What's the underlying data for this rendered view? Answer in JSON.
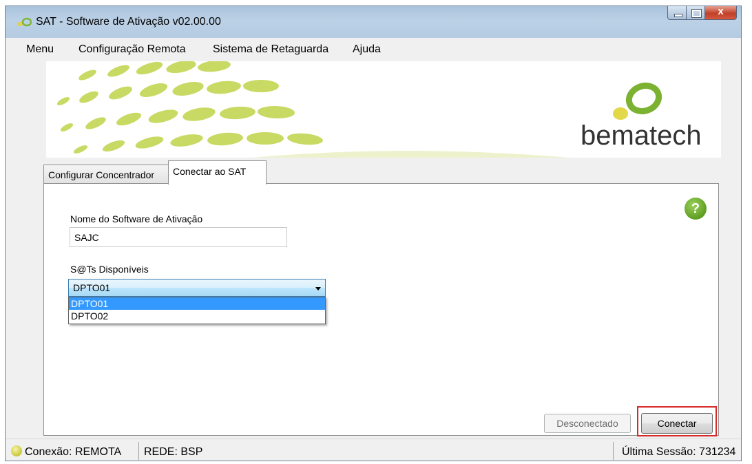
{
  "window": {
    "title": "SAT - Software de Ativação v02.00.00",
    "controls": {
      "close": "x"
    }
  },
  "menu": [
    "Menu",
    "Configuração Remota",
    "Sistema de Retaguarda",
    "Ajuda"
  ],
  "banner": {
    "brand": "bematech"
  },
  "tabs": [
    {
      "label": "Configurar Concentrador",
      "active": false
    },
    {
      "label": "Conectar ao SAT",
      "active": true
    }
  ],
  "form": {
    "software_label": "Nome do Software de Ativação",
    "software_value": "SAJC",
    "sats_label": "S@Ts Disponíveis",
    "sats_selected": "DPTO01",
    "sats_options": [
      "DPTO01",
      "DPTO02"
    ]
  },
  "help": {
    "glyph": "?"
  },
  "buttons": {
    "status": "Desconectado",
    "connect": "Conectar"
  },
  "statusbar": {
    "conexao": "Conexão: REMOTA",
    "rede": "REDE: BSP",
    "sessao": "Última Sessão: 731234"
  },
  "colors": {
    "accent_green": "#6aa82c",
    "selection": "#3399ff",
    "highlight_box": "#d62a2a"
  }
}
